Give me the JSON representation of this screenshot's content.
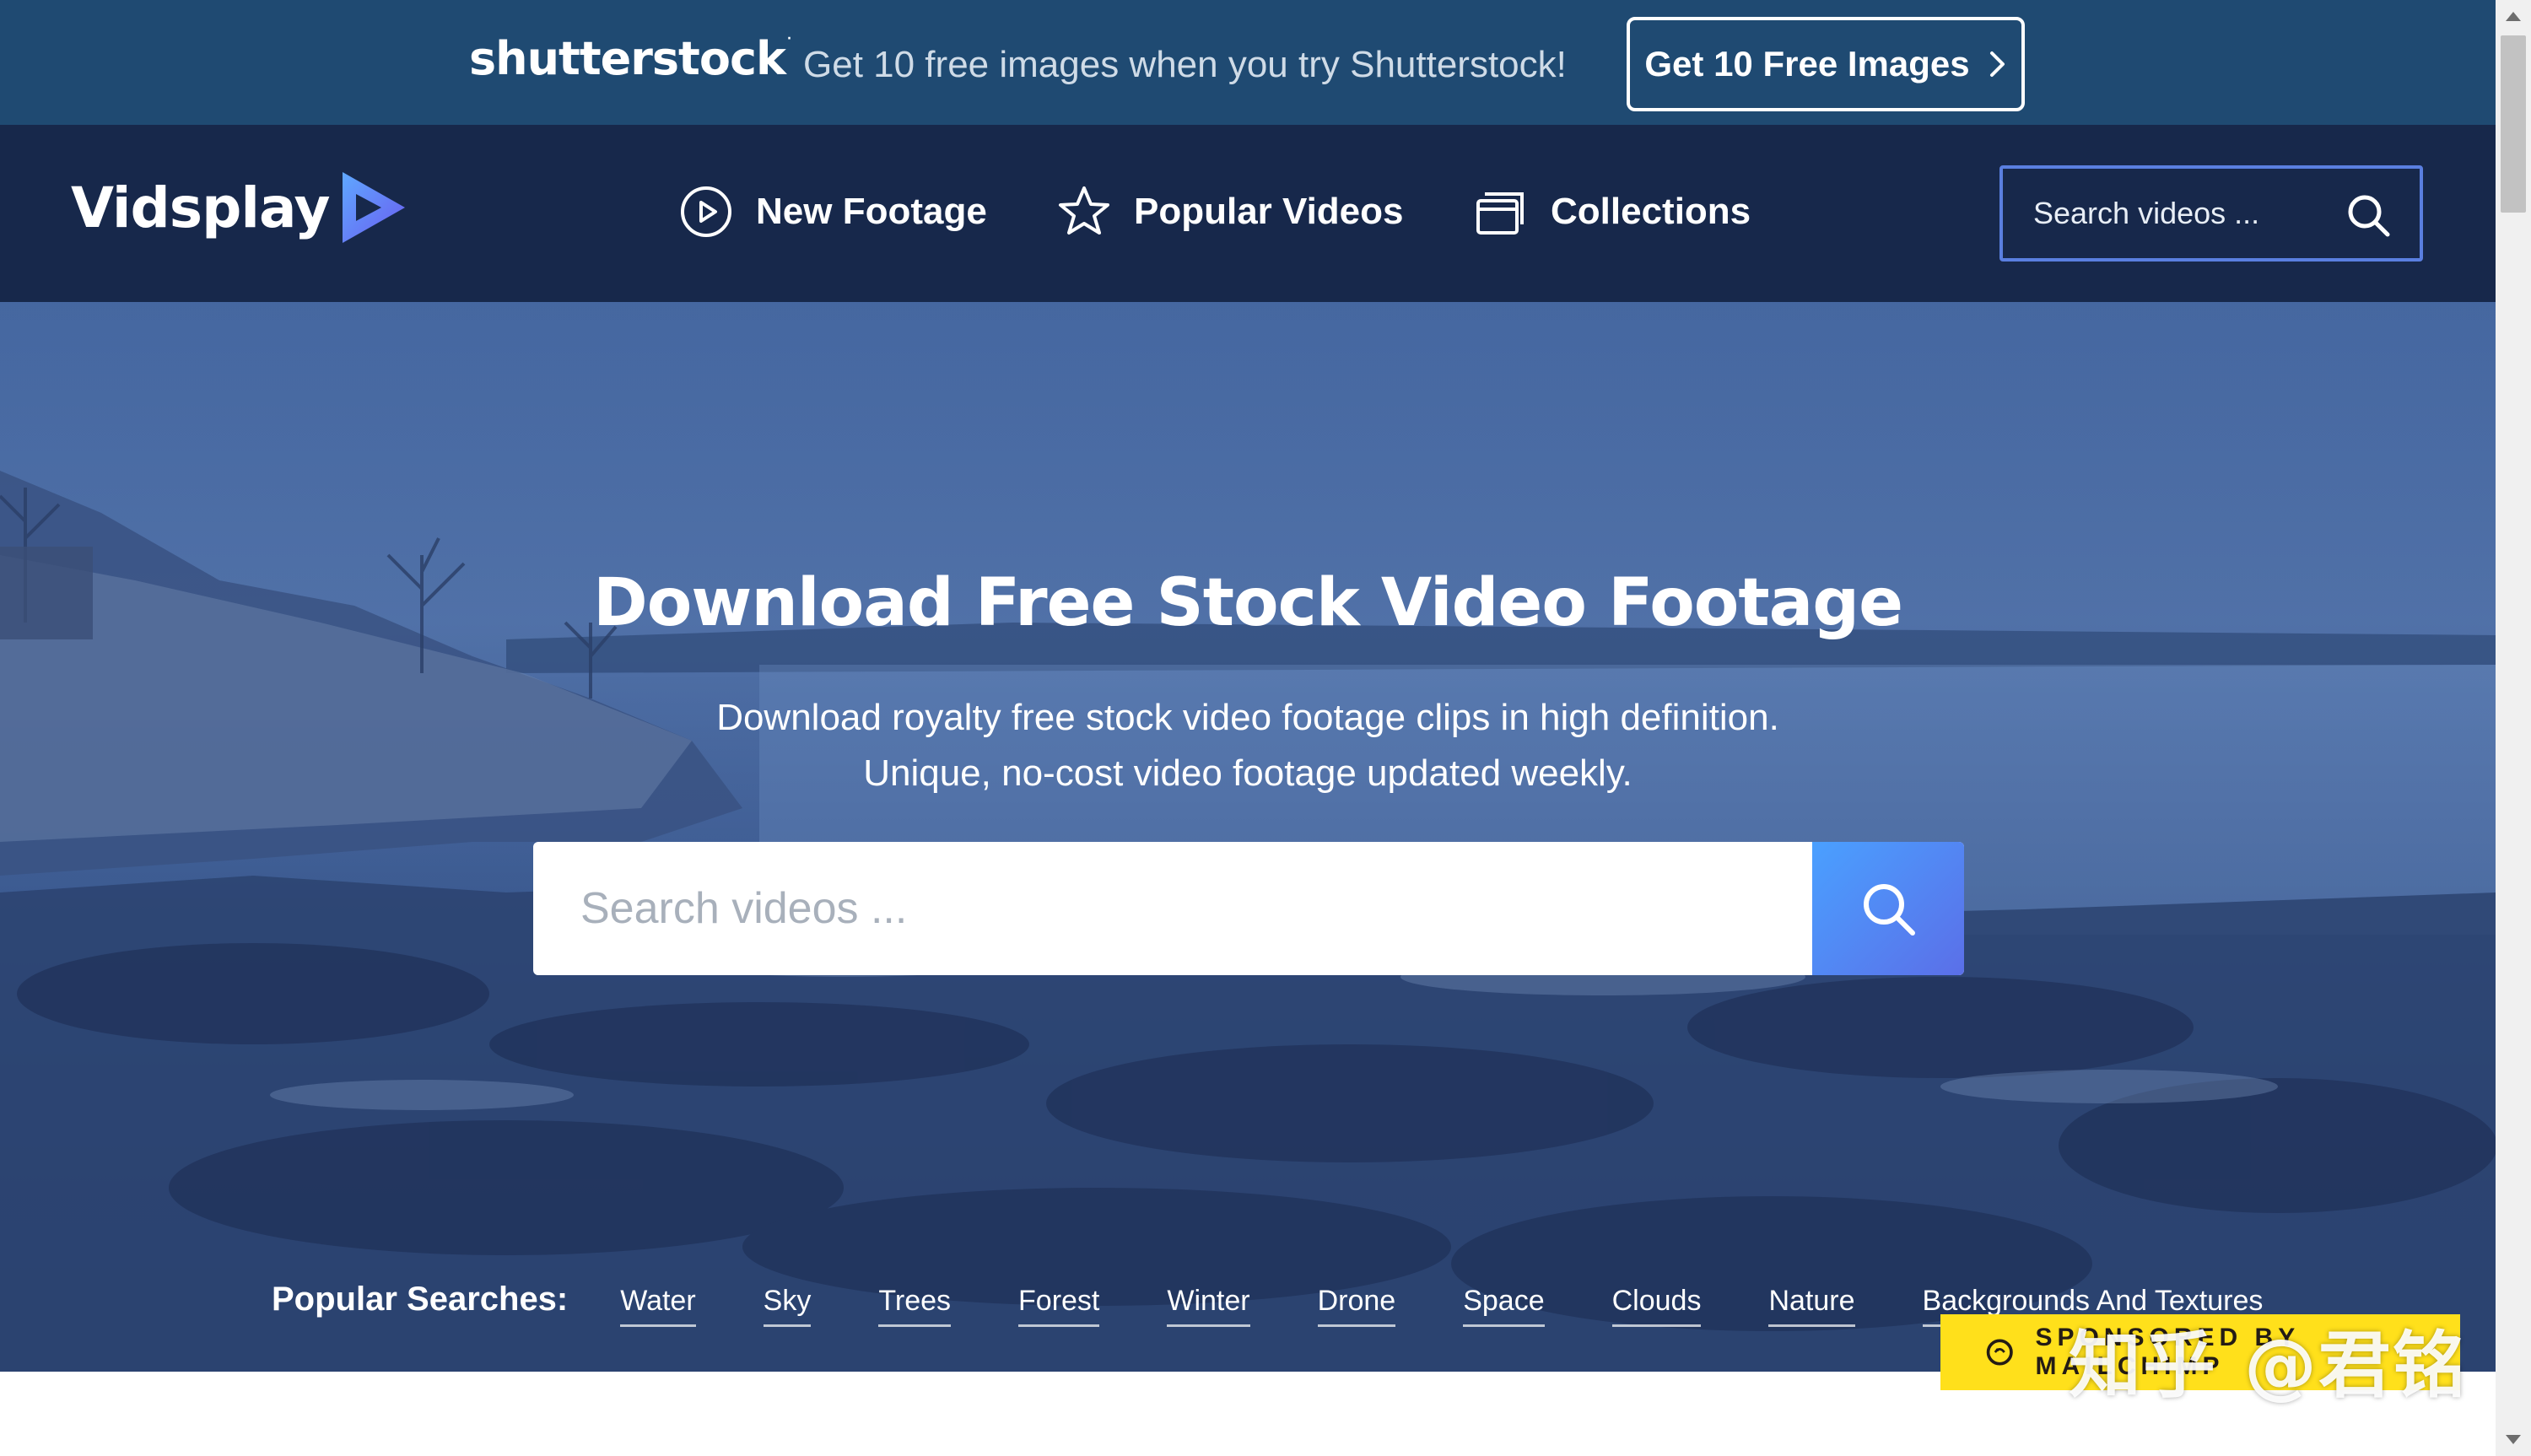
{
  "promo": {
    "logo": "shutterstock",
    "text": "Get 10 free images when you try Shutterstock!",
    "button_label": "Get 10 Free Images",
    "button_icon": "chevron-right-icon"
  },
  "nav": {
    "brand": "Vidsplay",
    "brand_icon": "play-logo-icon",
    "items": [
      {
        "label": "New Footage",
        "icon": "play-circle-icon"
      },
      {
        "label": "Popular Videos",
        "icon": "star-icon"
      },
      {
        "label": "Collections",
        "icon": "collections-icon"
      }
    ],
    "search_placeholder": "Search videos ...",
    "search_icon": "search-icon"
  },
  "hero": {
    "title": "Download Free Stock Video Footage",
    "subtitle_line1": "Download royalty free stock video footage clips in high definition.",
    "subtitle_line2": "Unique, no-cost video footage updated weekly.",
    "search_placeholder": "Search videos ..."
  },
  "popular": {
    "label": "Popular Searches:",
    "tags": [
      "Water",
      "Sky",
      "Trees",
      "Forest",
      "Winter",
      "Drone",
      "Space",
      "Clouds",
      "Nature",
      "Backgrounds And Textures"
    ]
  },
  "sponsor": {
    "text": "SPONSORED BY MAILCHIMP",
    "icon": "mailchimp-icon"
  },
  "watermark": "知乎 @君铭",
  "colors": {
    "promo_bg": "#1f4a72",
    "nav_bg": "#17284b",
    "accent_blue": "#4f7cf0",
    "sponsor_yellow": "#ffe01b"
  }
}
